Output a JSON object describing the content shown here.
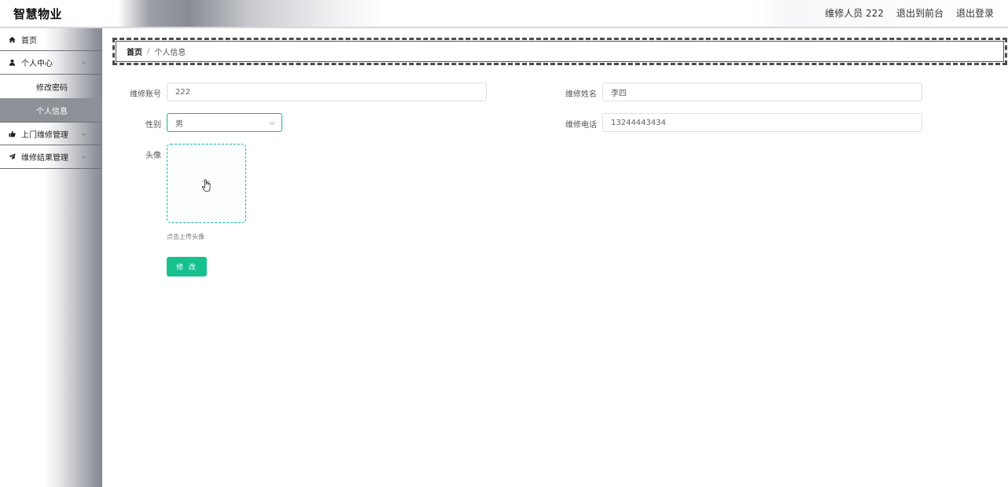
{
  "app": {
    "brand": "智慧物业"
  },
  "header": {
    "user_label": "维修人员 222",
    "to_front_label": "退出到前台",
    "logout_label": "退出登录"
  },
  "sidebar": {
    "items": [
      {
        "label": "首页",
        "icon": "home-icon"
      },
      {
        "label": "个人中心",
        "icon": "user-icon",
        "expanded": true,
        "children": [
          {
            "label": "修改密码",
            "active": false
          },
          {
            "label": "个人信息",
            "active": true
          }
        ]
      },
      {
        "label": "上门维修管理",
        "icon": "thumbs-up-icon",
        "expanded": false
      },
      {
        "label": "维修结果管理",
        "icon": "paper-plane-icon",
        "expanded": false
      }
    ]
  },
  "breadcrumb": {
    "home": "首页",
    "separator": "/",
    "current": "个人信息"
  },
  "form": {
    "account": {
      "label": "维修账号",
      "value": "222"
    },
    "name": {
      "label": "维修姓名",
      "value": "李四"
    },
    "gender": {
      "label": "性别",
      "value": "男"
    },
    "phone": {
      "label": "维修电话",
      "value": "13244443434"
    },
    "avatar": {
      "label": "头像",
      "hint": "点击上传头像"
    },
    "submit_label": "修 改"
  },
  "colors": {
    "accent": "#17b3a3",
    "button": "#17c08f",
    "sidebar_active": "#8d9197"
  }
}
